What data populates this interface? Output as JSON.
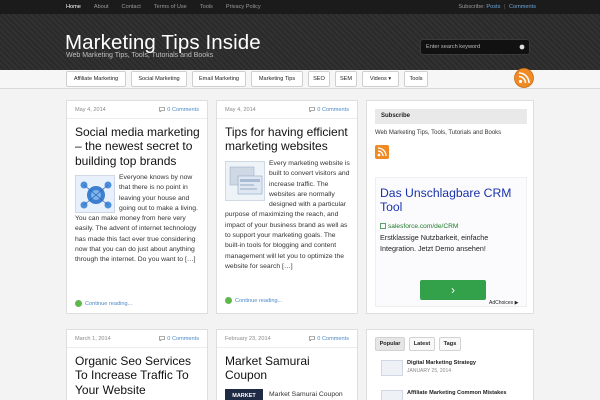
{
  "topnav": {
    "items": [
      {
        "label": "Home",
        "active": true
      },
      {
        "label": "About"
      },
      {
        "label": "Contact"
      },
      {
        "label": "Terms of Use"
      },
      {
        "label": "Tools"
      },
      {
        "label": "Privacy Policy"
      }
    ],
    "subscribe_label": "Subscribe:",
    "posts_label": "Posts",
    "separator": "|",
    "comments_label": "Comments"
  },
  "header": {
    "title": "Marketing Tips Inside",
    "description": "Web Marketing Tips, Tools, Tutorials and Books",
    "search_placeholder": "Enter search keyword"
  },
  "mainnav": {
    "items": [
      {
        "label": "Affiliate Marketing"
      },
      {
        "label": "Social Marketing"
      },
      {
        "label": "Email Marketing"
      },
      {
        "label": "Marketing Tips"
      },
      {
        "label": "SEO"
      },
      {
        "label": "SEM"
      },
      {
        "label": "Videos ▾"
      },
      {
        "label": "Tools"
      }
    ]
  },
  "posts": [
    {
      "date": "May 4, 2014",
      "comments": "0 Comments",
      "title": "Social media marketing – the newest secret to building top brands",
      "excerpt": "Everyone knows by now that there is no point in leaving your house and going out to make a living. You can make money from here very easily. The advent of internet technology has made this fact ever true considering now that you can do just about anything through the internet. Do you want to […]",
      "read_more": "Continue reading..."
    },
    {
      "date": "May 4, 2014",
      "comments": "0 Comments",
      "title": "Tips for having efficient marketing websites",
      "excerpt": "Every marketing website is built to convert visitors and increase traffic. The websites are normally designed with a particular purpose of maximizing the reach, and impact of your business brand as well as to support your marketing goals. The built-in tools for blogging and content management will let you to optimize the website for search […]",
      "read_more": "Continue reading..."
    },
    {
      "date": "March 1, 2014",
      "comments": "0 Comments",
      "title": "Organic Seo Services To Increase Traffic To Your Website"
    },
    {
      "date": "February 23, 2014",
      "comments": "0 Comments",
      "title": "Market Samurai Coupon",
      "excerpt": "Market Samurai Coupon",
      "thumb_label": "MARKET"
    }
  ],
  "sidebar": {
    "subscribe_title": "Subscribe",
    "subscribe_text": "Web Marketing Tips, Tools, Tutorials and Books",
    "ad": {
      "title": "Das Unschlagbare CRM Tool",
      "url": "salesforce.com/de/CRM",
      "body": "Erstklassige Nutzbarkeit, einfache Integration. Jetzt Demo ansehen!",
      "button": "›",
      "adchoices": "AdChoices ▶"
    },
    "tabs": [
      {
        "label": "Popular",
        "active": true
      },
      {
        "label": "Latest"
      },
      {
        "label": "Tags"
      }
    ],
    "popular": [
      {
        "title": "Digital Marketing Strategy",
        "date": "JANUARY 25, 2014"
      },
      {
        "title": "Affiliate Marketing Common Mistakes",
        "date": ""
      }
    ]
  },
  "colors": {
    "accent_link": "#4a89c8",
    "header_bg": "#2a2a2a",
    "ad_title": "#1a33a8",
    "ad_button": "#32a14a",
    "rss_orange": "#f08a24"
  }
}
